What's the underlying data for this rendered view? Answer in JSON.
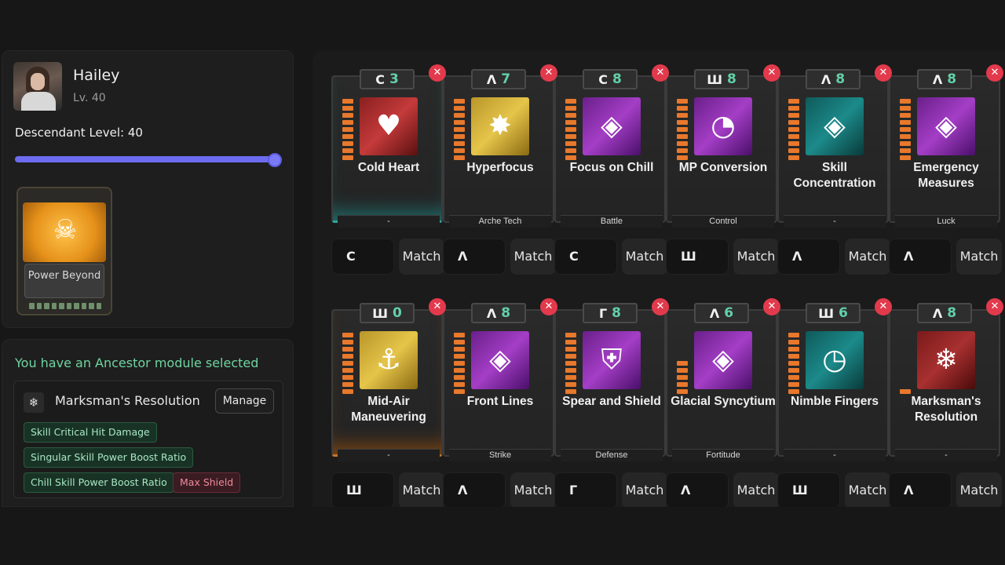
{
  "character": {
    "name": "Hailey",
    "level": "Lv. 40",
    "descendant_level_label": "Descendant Level: 40",
    "descendant_level": 40,
    "descendant_level_max": 40
  },
  "skin": {
    "label": "Power Beyond"
  },
  "ancestor": {
    "title": "You have an Ancestor module selected",
    "module_name": "Marksman's Resolution",
    "manage_label": "Manage",
    "tags": [
      {
        "text": "Skill Critical Hit Damage",
        "kind": "positive"
      },
      {
        "text": "Singular Skill Power Boost Ratio",
        "kind": "positive"
      },
      {
        "text": "Chill Skill Power Boost Ratio",
        "kind": "positive"
      },
      {
        "text": "Max Shield",
        "kind": "negative"
      }
    ]
  },
  "colors": {
    "accent": "#6d6cf0",
    "positive": "#6fd4a0",
    "negative": "#e23a4c",
    "capacity": "#e8782c",
    "cost": "#63d0a8"
  },
  "match_label": "Match",
  "modules": [
    {
      "name": "Cold Heart",
      "socket": "-",
      "symbol": "C",
      "cost": "3",
      "icon": "heart-icon",
      "glyph": "♥",
      "bg": "linear-gradient(135deg,#8a2020,#c43a3a 50%,#5a1010)",
      "bars": 9,
      "glow": "teal"
    },
    {
      "name": "Hyperfocus",
      "socket": "Arche Tech",
      "symbol": "Λ",
      "cost": "7",
      "icon": "burst-icon",
      "glyph": "✸",
      "bg": "linear-gradient(135deg,#b8962a,#e6c54a 50%,#8a6a12)",
      "bars": 9,
      "glow": ""
    },
    {
      "name": "Focus on Chill",
      "socket": "Battle",
      "symbol": "C",
      "cost": "8",
      "icon": "diamond-icon",
      "glyph": "◈",
      "bg": "linear-gradient(135deg,#6a1f8a,#a43ec6 50%,#4a0f6a)",
      "bars": 9,
      "glow": ""
    },
    {
      "name": "MP Conversion",
      "socket": "Control",
      "symbol": "Ш",
      "cost": "8",
      "icon": "gauge-icon",
      "glyph": "◔",
      "bg": "linear-gradient(135deg,#6a1f8a,#a43ec6 50%,#4a0f6a)",
      "bars": 9,
      "glow": ""
    },
    {
      "name": "Skill Concentration",
      "socket": "-",
      "symbol": "Λ",
      "cost": "8",
      "icon": "diamond-icon",
      "glyph": "◈",
      "bg": "linear-gradient(135deg,#0f5a5a,#1c8a8a 50%,#0a3a3a)",
      "bars": 9,
      "glow": ""
    },
    {
      "name": "Emergency Measures",
      "socket": "Luck",
      "symbol": "Λ",
      "cost": "8",
      "icon": "diamond-icon",
      "glyph": "◈",
      "bg": "linear-gradient(135deg,#6a1f8a,#a43ec6 50%,#4a0f6a)",
      "bars": 9,
      "glow": ""
    },
    {
      "name": "Mid-Air Maneuvering",
      "socket": "-",
      "symbol": "Ш",
      "cost": "0",
      "icon": "grapple-icon",
      "glyph": "⚓",
      "bg": "linear-gradient(135deg,#b8962a,#e6c54a 50%,#8a6a12)",
      "bars": 9,
      "glow": "orange"
    },
    {
      "name": "Front Lines",
      "socket": "Strike",
      "symbol": "Λ",
      "cost": "8",
      "icon": "diamond-icon",
      "glyph": "◈",
      "bg": "linear-gradient(135deg,#6a1f8a,#a43ec6 50%,#4a0f6a)",
      "bars": 9,
      "glow": ""
    },
    {
      "name": "Spear and Shield",
      "socket": "Defense",
      "symbol": "Г",
      "cost": "8",
      "icon": "shield-icon",
      "glyph": "⛨",
      "bg": "linear-gradient(135deg,#6a1f8a,#a43ec6 50%,#4a0f6a)",
      "bars": 9,
      "glow": ""
    },
    {
      "name": "Glacial Syncytium",
      "socket": "Fortitude",
      "symbol": "Λ",
      "cost": "6",
      "icon": "diamond-icon",
      "glyph": "◈",
      "bg": "linear-gradient(135deg,#6a1f8a,#a43ec6 50%,#4a0f6a)",
      "bars": 5,
      "glow": ""
    },
    {
      "name": "Nimble Fingers",
      "socket": "-",
      "symbol": "Ш",
      "cost": "6",
      "icon": "timer-icon",
      "glyph": "◷",
      "bg": "linear-gradient(135deg,#0f5a5a,#1c8a8a 50%,#0a3a3a)",
      "bars": 9,
      "glow": ""
    },
    {
      "name": "Marksman's Resolution",
      "socket": "-",
      "symbol": "Λ",
      "cost": "8",
      "icon": "snowflake-icon",
      "glyph": "❄",
      "bg": "linear-gradient(135deg,#7a1a1a,#a83030 50%,#4a0a0a)",
      "bars": 1,
      "glow": ""
    }
  ],
  "slot_symbols": [
    [
      "C",
      "Λ",
      "C",
      "Ш",
      "Λ",
      "Λ"
    ],
    [
      "Ш",
      "Λ",
      "Г",
      "Λ",
      "Ш",
      "Λ"
    ]
  ]
}
